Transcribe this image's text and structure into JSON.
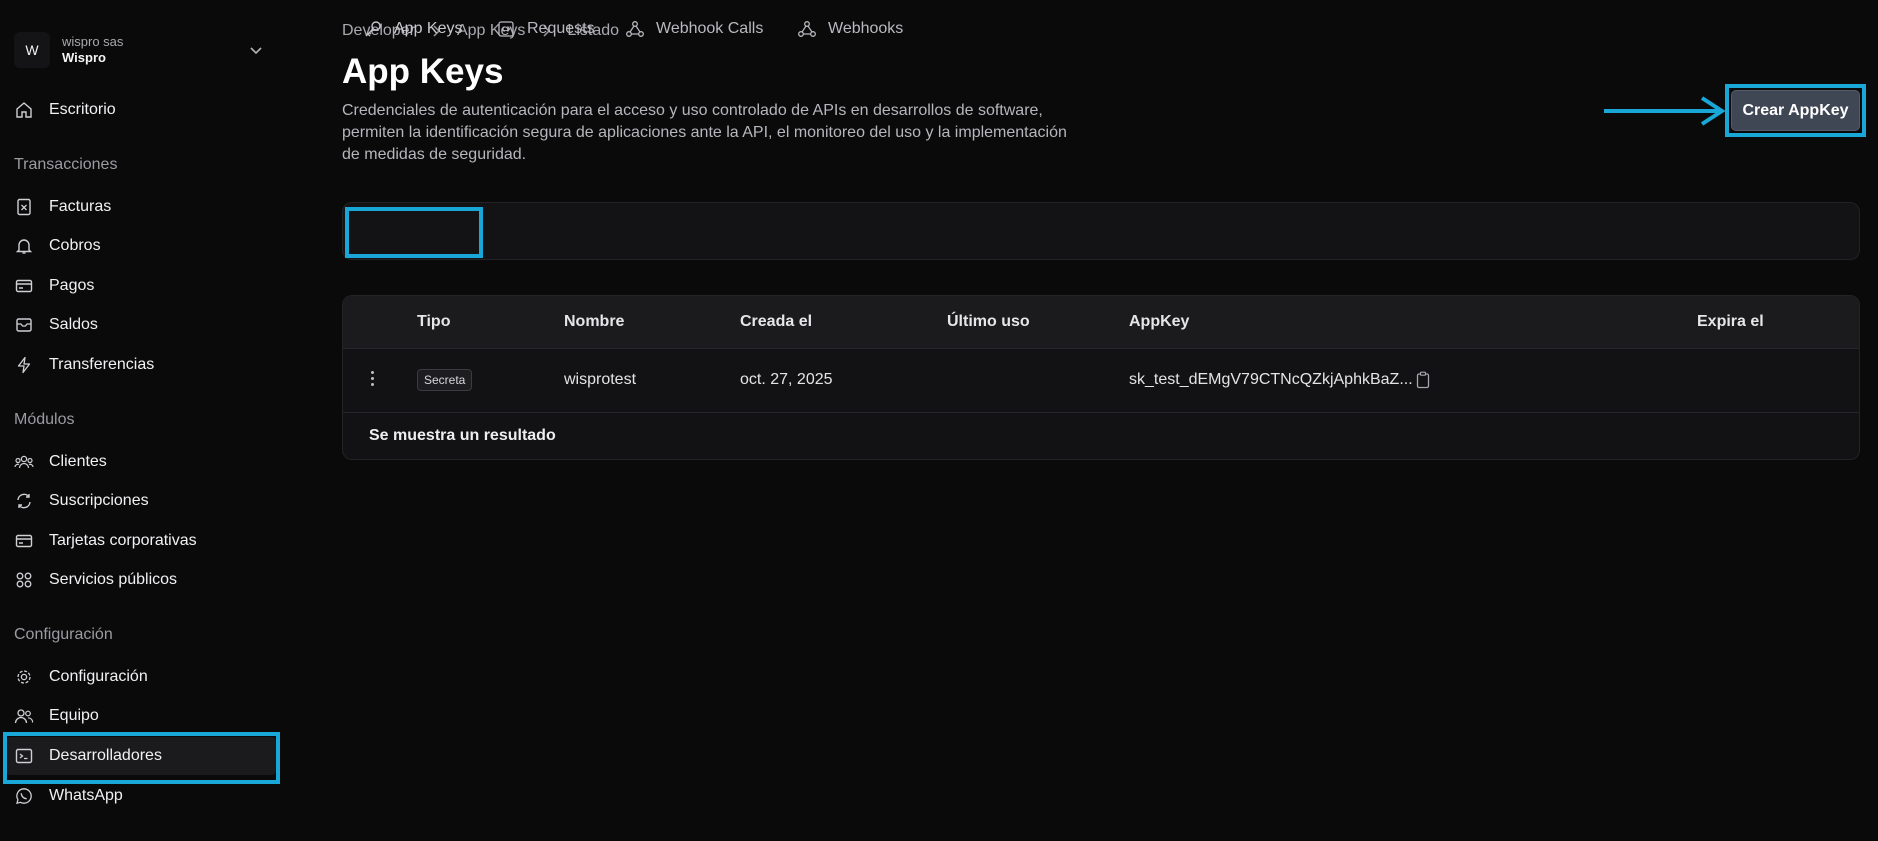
{
  "org": {
    "initial": "W",
    "subtitle": "wispro sas",
    "name": "Wispro"
  },
  "sidebar": {
    "top_item": "Escritorio",
    "sections": {
      "transacciones": "Transacciones",
      "modulos": "Módulos",
      "configuracion": "Configuración"
    },
    "items": {
      "facturas": "Facturas",
      "cobros": "Cobros",
      "pagos": "Pagos",
      "saldos": "Saldos",
      "transferencias": "Transferencias",
      "clientes": "Clientes",
      "suscripciones": "Suscripciones",
      "tarjetas": "Tarjetas corporativas",
      "servicios": "Servicios públicos",
      "configuracion": "Configuración",
      "equipo": "Equipo",
      "desarrolladores": "Desarrolladores",
      "whatsapp": "WhatsApp"
    }
  },
  "breadcrumb": [
    "Developer",
    "App Keys",
    "Listado"
  ],
  "page": {
    "title": "App Keys",
    "description": "Credenciales de autenticación para el acceso y uso controlado de APIs en desarrollos de software, permiten la identificación segura de aplicaciones ante la API, el monitoreo del uso y la implementación de medidas de seguridad."
  },
  "actions": {
    "create_label": "Crear AppKey"
  },
  "tabs": [
    "App Keys",
    "Requests",
    "Webhook Calls",
    "Webhooks"
  ],
  "table": {
    "headers": [
      "Tipo",
      "Nombre",
      "Creada el",
      "Último uso",
      "AppKey",
      "Expira el"
    ],
    "rows": [
      {
        "tipo": "Secreta",
        "nombre": "wisprotest",
        "creada": "oct. 27, 2025",
        "ultimo_uso": "",
        "appkey": "sk_test_dEMgV79CTNcQZkjAphkBaZ...",
        "expira": ""
      }
    ],
    "footer": "Se muestra un resultado"
  },
  "colors": {
    "highlight": "#18a7d6",
    "background": "#0a0a0b",
    "button": "#3f4654"
  }
}
